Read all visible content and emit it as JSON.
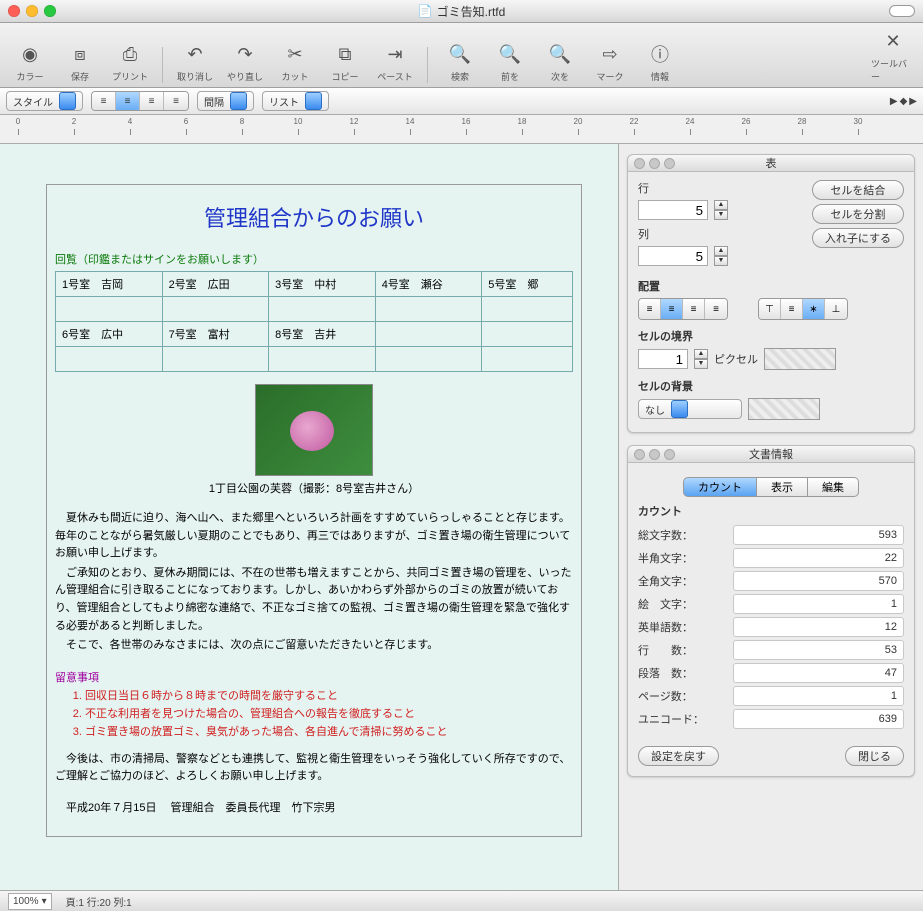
{
  "window": {
    "title": "ゴミ告知.rtfd"
  },
  "toolbar": {
    "items": [
      {
        "id": "color",
        "label": "カラー",
        "glyph": "◉"
      },
      {
        "id": "save",
        "label": "保存",
        "glyph": "⧈"
      },
      {
        "id": "print",
        "label": "プリント",
        "glyph": "⎙"
      },
      {
        "id": "undo",
        "label": "取り消し",
        "glyph": "↶"
      },
      {
        "id": "redo",
        "label": "やり直し",
        "glyph": "↷"
      },
      {
        "id": "cut",
        "label": "カット",
        "glyph": "✂"
      },
      {
        "id": "copy",
        "label": "コピー",
        "glyph": "⧉"
      },
      {
        "id": "paste",
        "label": "ペースト",
        "glyph": "⇥"
      },
      {
        "id": "find",
        "label": "検索",
        "glyph": "🔍"
      },
      {
        "id": "prev",
        "label": "前を",
        "glyph": "🔍"
      },
      {
        "id": "next",
        "label": "次を",
        "glyph": "🔍"
      },
      {
        "id": "mark",
        "label": "マーク",
        "glyph": "⇨"
      },
      {
        "id": "info",
        "label": "情報",
        "glyph": "ⓘ"
      }
    ],
    "customize": "ツールバー"
  },
  "formatbar": {
    "style": "スタイル",
    "spacing": "間隔",
    "list": "リスト"
  },
  "ruler": {
    "marks": [
      0,
      2,
      4,
      6,
      8,
      10,
      12,
      14,
      16,
      18,
      20,
      22,
      24,
      26,
      28,
      30
    ]
  },
  "doc": {
    "title": "管理組合からのお願い",
    "circulation": "回覧（印鑑またはサインをお願いします）",
    "rooms": [
      [
        "1号室　吉岡",
        "2号室　広田",
        "3号室　中村",
        "4号室　瀬谷",
        "5号室　郷"
      ],
      [
        "",
        "",
        "",
        "",
        ""
      ],
      [
        "6号室　広中",
        "7号室　富村",
        "8号室　吉井",
        "",
        ""
      ],
      [
        "",
        "",
        "",
        "",
        ""
      ]
    ],
    "caption": "1丁目公園の芙蓉（撮影：8号室吉井さん）",
    "para1": "夏休みも間近に迫り、海へ山へ、また郷里へといろいろ計画をすすめていらっしゃることと存じます。毎年のことながら暑気厳しい夏期のことでもあり、再三ではありますが、ゴミ置き場の衛生管理についてお願い申し上げます。",
    "para2": "ご承知のとおり、夏休み期間には、不在の世帯も増えますことから、共同ゴミ置き場の管理を、いったん管理組合に引き取ることになっております。しかし、あいかわらず外部からのゴミの放置が続いており、管理組合としてもより綿密な連絡で、不正なゴミ捨ての監視、ゴミ置き場の衛生管理を緊急で強化する必要があると判断しました。",
    "para3": "そこで、各世帯のみなさまには、次の点にご留意いただきたいと存じます。",
    "notes_title": "留意事項",
    "notes": [
      "回収日当日６時から８時までの時間を厳守すること",
      "不正な利用者を見つけた場合の、管理組合への報告を徹底すること",
      "ゴミ置き場の放置ゴミ、臭気があった場合、各自進んで清掃に努めること"
    ],
    "para4": "今後は、市の清掃局、警察などとも連携して、監視と衛生管理をいっそう強化していく所存ですので、ご理解とご協力のほど、よろしくお願い申し上げます。",
    "sign": "平成20年７月15日　 管理組合　委員長代理　竹下宗男"
  },
  "table_panel": {
    "title": "表",
    "row_label": "行",
    "row_val": "5",
    "col_label": "列",
    "col_val": "5",
    "merge": "セルを結合",
    "split": "セルを分割",
    "nest": "入れ子にする",
    "align_label": "配置",
    "border_label": "セルの境界",
    "border_val": "1",
    "border_unit": "ピクセル",
    "bg_label": "セルの背景",
    "bg_val": "なし"
  },
  "info_panel": {
    "title": "文書情報",
    "tabs": [
      "カウント",
      "表示",
      "編集"
    ],
    "section": "カウント",
    "rows": [
      {
        "k": "総文字数：",
        "v": "593"
      },
      {
        "k": "半角文字：",
        "v": "22"
      },
      {
        "k": "全角文字：",
        "v": "570"
      },
      {
        "k": "絵　文字：",
        "v": "1"
      },
      {
        "k": "英単語数：",
        "v": "12"
      },
      {
        "k": "行　　数：",
        "v": "53"
      },
      {
        "k": "段落　数：",
        "v": "47"
      },
      {
        "k": "ページ数：",
        "v": "1"
      },
      {
        "k": "ユニコード：",
        "v": "639"
      }
    ],
    "reset": "設定を戻す",
    "close": "閉じる"
  },
  "status": {
    "zoom": "100%",
    "pos": "頁:1 行:20 列:1"
  }
}
